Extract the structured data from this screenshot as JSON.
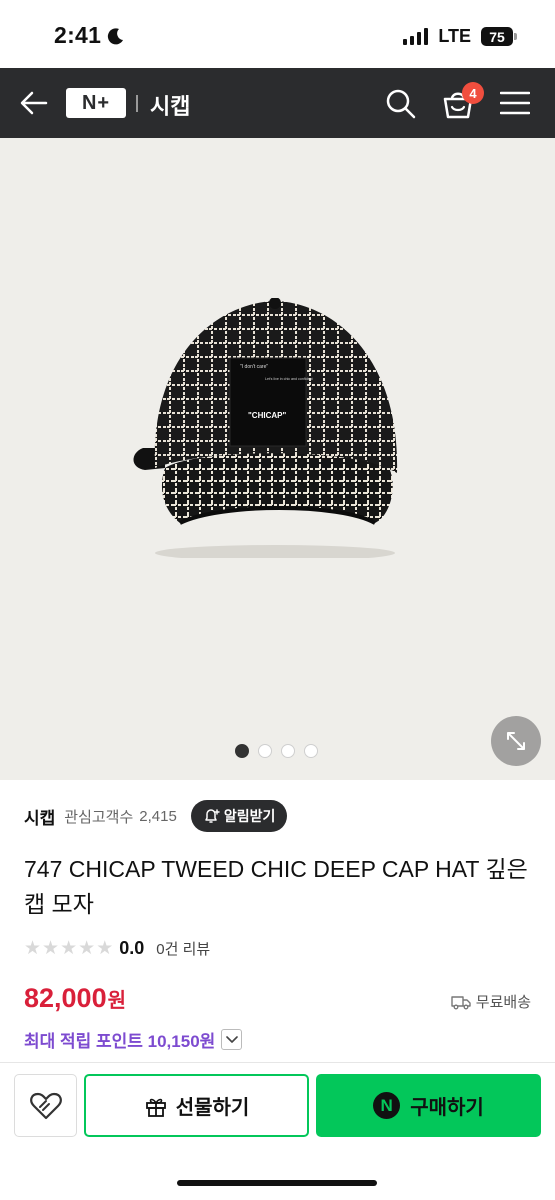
{
  "status_bar": {
    "time": "2:41",
    "network": "LTE",
    "battery": "75"
  },
  "nav": {
    "logo": "N+",
    "store_title": "시캡",
    "cart_badge": "4"
  },
  "product": {
    "store_name": "시캡",
    "interest_label": "관심고객수",
    "interest_count": "2,415",
    "alarm_label": "알림받기",
    "title": "747 CHICAP TWEED CHIC DEEP CAP HAT 깊은 캡 모자",
    "rating_score": "0.0",
    "review_count": "0건 리뷰",
    "rating_stars": 0,
    "price": "82,000",
    "price_unit": "원",
    "shipping": "무료배송",
    "points_label": "최대 적립 포인트 10,150원",
    "image_count": 4,
    "active_image": 1,
    "cap_label_top": "\"I don't care\"",
    "cap_label_mid": "Let's live in chic and confident",
    "cap_label_brand": "\"CHICAP\""
  },
  "actions": {
    "gift_label": "선물하기",
    "buy_label": "구매하기",
    "npay_glyph": "N"
  },
  "colors": {
    "accent_green": "#03c75a",
    "price_red": "#d9203a",
    "points_purple": "#7d4bd0",
    "nav_bg": "#2b2c2e",
    "badge_red": "#f04e3e"
  },
  "icons": [
    "moon-icon",
    "back-arrow-icon",
    "search-icon",
    "cart-icon",
    "menu-icon",
    "expand-icon",
    "bell-plus-icon",
    "star-icon",
    "truck-icon",
    "chevron-down-icon",
    "heart-link-icon",
    "gift-icon",
    "npay-icon"
  ]
}
